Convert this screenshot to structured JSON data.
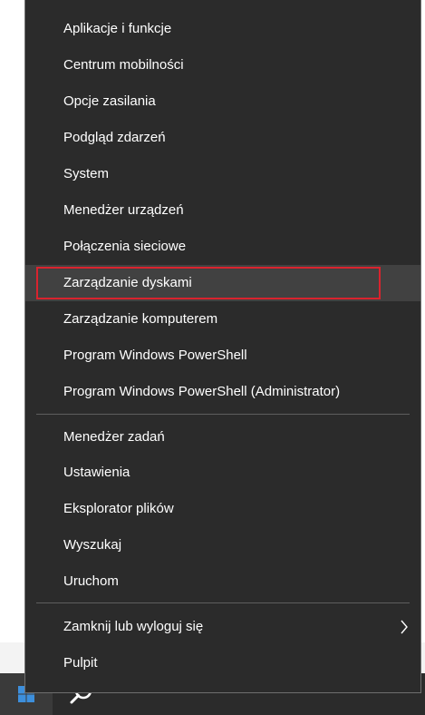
{
  "menu": {
    "groups": [
      {
        "items": [
          {
            "label": "Aplikacje i funkcje"
          },
          {
            "label": "Centrum mobilności"
          },
          {
            "label": "Opcje zasilania"
          },
          {
            "label": "Podgląd zdarzeń"
          },
          {
            "label": "System"
          },
          {
            "label": "Menedżer urządzeń"
          },
          {
            "label": "Połączenia sieciowe"
          },
          {
            "label": "Zarządzanie dyskami",
            "highlighted": true
          },
          {
            "label": "Zarządzanie komputerem"
          },
          {
            "label": "Program Windows PowerShell"
          },
          {
            "label": "Program Windows PowerShell (Administrator)"
          }
        ]
      },
      {
        "items": [
          {
            "label": "Menedżer zadań"
          },
          {
            "label": "Ustawienia"
          },
          {
            "label": "Eksplorator plików"
          },
          {
            "label": "Wyszukaj"
          },
          {
            "label": "Uruchom"
          }
        ]
      },
      {
        "items": [
          {
            "label": "Zamknij lub wyloguj się",
            "submenu_icon": "chevron-right-icon"
          },
          {
            "label": "Pulpit"
          }
        ]
      }
    ]
  },
  "taskbar": {
    "start_icon": "windows-logo-icon",
    "search_icon": "search-icon"
  },
  "colors": {
    "menu_background": "#2b2b2b",
    "menu_text": "#ffffff",
    "hover_background": "#414141",
    "highlight_border": "#d9232e",
    "taskbar": "#2b2b2b",
    "start_logo": "#3d8fdc"
  }
}
